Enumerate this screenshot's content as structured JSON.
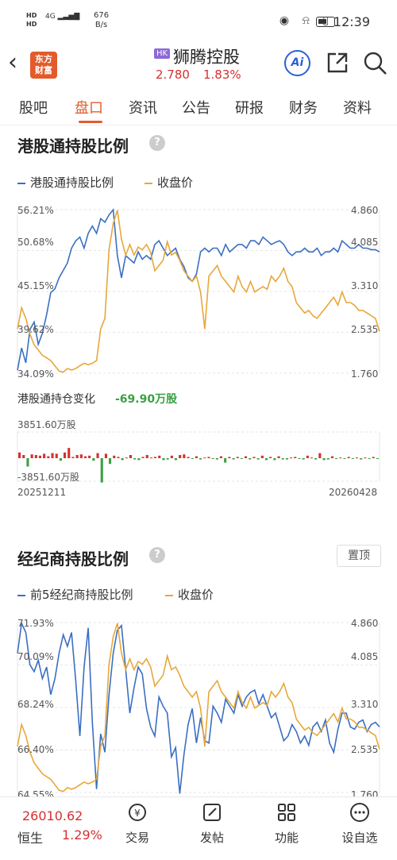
{
  "status": {
    "net": "4G",
    "rate_value": "676",
    "rate_unit": "B/s",
    "time": "12:39"
  },
  "header": {
    "logo_line1": "东方",
    "logo_line2": "财富",
    "market_badge": "HK",
    "stock_name": "狮腾控股",
    "price": "2.780",
    "change_pct": "1.83%",
    "ai_label": "Ai"
  },
  "tabs": [
    "股吧",
    "盘口",
    "资讯",
    "公告",
    "研报",
    "财务",
    "资料"
  ],
  "active_tab": 1,
  "section1": {
    "title": "港股通持股比例",
    "legend_ratio": "港股通持股比例",
    "legend_price": "收盘价",
    "left_ticks": [
      "56.21%",
      "50.68%",
      "45.15%",
      "39.62%",
      "34.09%"
    ],
    "right_ticks": [
      "4.860",
      "4.085",
      "3.310",
      "2.535",
      "1.760"
    ],
    "change_label": "港股通持仓变化",
    "change_value": "-69.90万股",
    "bar_max_label": "3851.60万股",
    "bar_min_label": "-3851.60万股",
    "start_date": "20251211",
    "end_date": "20260428"
  },
  "section2": {
    "title": "经纪商持股比例",
    "pin_label": "置顶",
    "legend_ratio": "前5经纪商持股比例",
    "legend_price": "收盘价",
    "left_ticks": [
      "71.93%",
      "70.09%",
      "68.24%",
      "66.40%",
      "64.55%"
    ],
    "right_ticks": [
      "4.860",
      "4.085",
      "3.310",
      "2.535",
      "1.760"
    ]
  },
  "bottom": {
    "index_value": "26010.62",
    "index_name": "恒生",
    "index_pct": "1.29%",
    "nav": [
      "交易",
      "发帖",
      "功能",
      "设自选"
    ]
  },
  "colors": {
    "ratio": "#3a6fc2",
    "price": "#e8a73a",
    "up": "#d43030",
    "down": "#3aa043",
    "accent": "#e35b2a"
  },
  "chart_data": [
    {
      "type": "line",
      "title": "港股通持股比例",
      "series": [
        {
          "name": "港股通持股比例",
          "axis": "left",
          "values": [
            34.5,
            37.5,
            35.5,
            40,
            41,
            38,
            39.5,
            42,
            45,
            45.5,
            47,
            48,
            49,
            51,
            52,
            52.5,
            51,
            53,
            54,
            53,
            55,
            54.5,
            55.5,
            56.2,
            50,
            47,
            50,
            49.5,
            49,
            50.5,
            49.5,
            50,
            49.5,
            51.5,
            52,
            51,
            50,
            50.5,
            51,
            49.5,
            48.5,
            47,
            46.5,
            47.5,
            50.5,
            51,
            50.5,
            51,
            51,
            50,
            51.5,
            50.5,
            51,
            51.5,
            51.5,
            51,
            52,
            52,
            51.5,
            52.5,
            52,
            51.5,
            51.8,
            52,
            51.5,
            50.5,
            50,
            50.5,
            50.5,
            51,
            50.5,
            50.5,
            51,
            50,
            50.5,
            50.5,
            51,
            50.5,
            52,
            51.5,
            51,
            51,
            51.5,
            51,
            51,
            50.8,
            50.8,
            50.5
          ]
        },
        {
          "name": "收盘价",
          "axis": "right",
          "values": [
            2.6,
            3.0,
            2.8,
            2.5,
            2.3,
            2.2,
            2.1,
            2.05,
            2.0,
            1.9,
            1.8,
            1.78,
            1.85,
            1.82,
            1.85,
            1.9,
            1.95,
            1.92,
            1.95,
            2.0,
            2.6,
            2.8,
            4.1,
            4.6,
            4.85,
            4.3,
            4.0,
            4.2,
            4.0,
            4.15,
            4.1,
            4.2,
            4.05,
            3.7,
            3.8,
            3.9,
            4.25,
            4.0,
            4.05,
            3.9,
            3.7,
            3.6,
            3.5,
            3.6,
            3.3,
            2.6,
            3.6,
            3.7,
            3.8,
            3.6,
            3.5,
            3.4,
            3.3,
            3.6,
            3.4,
            3.3,
            3.5,
            3.3,
            3.35,
            3.4,
            3.35,
            3.6,
            3.5,
            3.6,
            3.75,
            3.5,
            3.4,
            3.1,
            3.0,
            2.9,
            2.95,
            2.85,
            2.8,
            2.9,
            3.0,
            3.1,
            3.2,
            3.05,
            3.3,
            3.1,
            3.1,
            3.05,
            2.95,
            2.95,
            2.9,
            2.85,
            2.8,
            2.55
          ]
        }
      ],
      "left_ylim": [
        34.09,
        56.21
      ],
      "right_ylim": [
        1.76,
        4.86
      ]
    },
    {
      "type": "bar",
      "title": "港股通持仓变化",
      "x_range": [
        "20251211",
        "20260428"
      ],
      "ylim": [
        -3851.6,
        3851.6
      ],
      "values": [
        900,
        500,
        -1300,
        600,
        500,
        400,
        700,
        300,
        800,
        700,
        -400,
        900,
        1600,
        200,
        500,
        600,
        300,
        400,
        -400,
        800,
        -3800,
        700,
        -900,
        400,
        200,
        -300,
        100,
        500,
        -200,
        -300,
        200,
        500,
        100,
        200,
        400,
        -300,
        -200,
        400,
        -300,
        500,
        600,
        200,
        -100,
        300,
        -200,
        100,
        200,
        -100,
        -200,
        300,
        -700,
        200,
        -200,
        200,
        -100,
        300,
        -200,
        200,
        -200,
        400,
        -300,
        200,
        -300,
        300,
        -200,
        -200,
        100,
        200,
        -100,
        -200,
        400,
        100,
        -200,
        800,
        -300,
        -200,
        300,
        -100,
        100,
        -100,
        200,
        -100,
        100,
        -200,
        100,
        -100,
        200,
        -100
      ]
    },
    {
      "type": "line",
      "title": "经纪商持股比例",
      "series": [
        {
          "name": "前5经纪商持股比例",
          "axis": "left",
          "values": [
            70.6,
            71.9,
            71.5,
            70.1,
            69.8,
            70.3,
            69.5,
            70.0,
            68.8,
            69.5,
            70.6,
            71.4,
            70.9,
            71.5,
            69.4,
            67.0,
            70.0,
            71.7,
            67.6,
            64.7,
            67.1,
            66.3,
            68.8,
            70.6,
            71.6,
            71.8,
            69.9,
            68.0,
            69.1,
            70.0,
            69.7,
            68.2,
            67.4,
            67.0,
            68.7,
            68.3,
            68.0,
            66.1,
            66.5,
            64.5,
            66.2,
            67.5,
            68.2,
            66.7,
            67.8,
            66.8,
            66.7,
            68.3,
            68.0,
            67.6,
            68.6,
            68.3,
            68.0,
            68.8,
            68.3,
            68.7,
            68.9,
            69.0,
            68.4,
            68.8,
            68.3,
            67.8,
            68.0,
            67.4,
            66.8,
            67.0,
            67.5,
            67.2,
            66.7,
            67.0,
            66.6,
            67.4,
            67.6,
            67.2,
            67.7,
            66.7,
            66.3,
            67.3,
            68.0,
            68.0,
            67.4,
            67.3,
            67.6,
            67.7,
            67.2,
            67.5,
            67.6,
            67.4
          ]
        },
        {
          "name": "收盘价",
          "axis": "right",
          "values": [
            2.6,
            3.0,
            2.8,
            2.5,
            2.3,
            2.2,
            2.1,
            2.05,
            2.0,
            1.9,
            1.8,
            1.78,
            1.85,
            1.82,
            1.85,
            1.9,
            1.95,
            1.92,
            1.95,
            2.0,
            2.6,
            2.8,
            4.1,
            4.6,
            4.85,
            4.3,
            4.0,
            4.2,
            4.0,
            4.15,
            4.1,
            4.2,
            4.05,
            3.7,
            3.8,
            3.9,
            4.25,
            4.0,
            4.05,
            3.9,
            3.7,
            3.6,
            3.5,
            3.6,
            3.3,
            2.6,
            3.6,
            3.7,
            3.8,
            3.6,
            3.5,
            3.4,
            3.3,
            3.6,
            3.4,
            3.3,
            3.5,
            3.3,
            3.35,
            3.4,
            3.35,
            3.6,
            3.5,
            3.6,
            3.75,
            3.5,
            3.4,
            3.1,
            3.0,
            2.9,
            2.95,
            2.85,
            2.8,
            2.9,
            3.0,
            3.1,
            3.2,
            3.05,
            3.3,
            3.1,
            3.1,
            3.05,
            2.95,
            2.95,
            2.9,
            2.85,
            2.8,
            2.55
          ]
        }
      ],
      "left_ylim": [
        64.55,
        71.93
      ],
      "right_ylim": [
        1.76,
        4.86
      ]
    }
  ]
}
